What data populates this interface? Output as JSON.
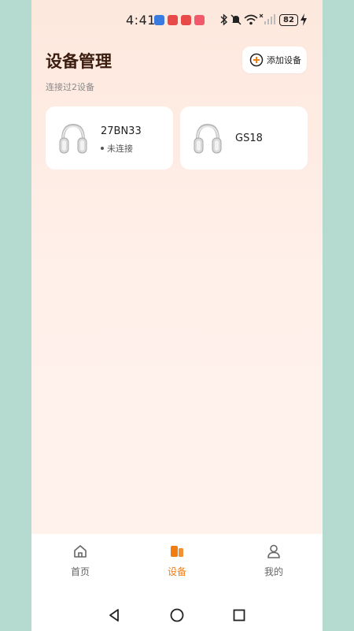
{
  "status_bar": {
    "time": "4:41",
    "battery": "82"
  },
  "header": {
    "title": "设备管理",
    "add_device_label": "添加设备",
    "subtitle": "连接过2设备"
  },
  "devices": [
    {
      "name": "27BN33",
      "status": "未连接"
    },
    {
      "name": "GS18",
      "status": ""
    }
  ],
  "bottom_nav": {
    "items": [
      {
        "label": "首页",
        "icon": "home-icon",
        "active": false
      },
      {
        "label": "设备",
        "icon": "devices-icon",
        "active": true
      },
      {
        "label": "我的",
        "icon": "profile-icon",
        "active": false
      }
    ]
  },
  "colors": {
    "accent": "#f07d12",
    "title": "#3a1d0e",
    "side_background": "#b5dbd0"
  }
}
